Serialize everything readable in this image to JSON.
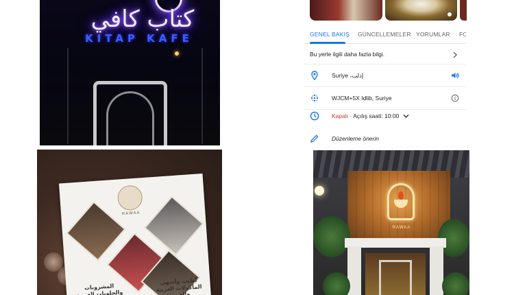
{
  "photos": {
    "sign": {
      "arabic": "كتاب كافي",
      "latin": "KITAP KAFE"
    },
    "menu_card": {
      "brand": "RAWAA",
      "text_left": "المشروبات والحلويات الغربية بمذاق أصيل",
      "text_right": "أطيب وأشهى المأكولات الغربية والعربية"
    },
    "entrance": {
      "logo_text": "RAWAA"
    }
  },
  "tabs": [
    {
      "label": "GENEL BAKIŞ",
      "active": true
    },
    {
      "label": "GÜNCELLEMELER",
      "active": false
    },
    {
      "label": "YORUMLAR",
      "active": false
    },
    {
      "label": "FO",
      "active": false
    }
  ],
  "info": {
    "more_info": "Bu yerle ilgili daha fazla bilgi.",
    "location": "Suriye ،إدلب",
    "plus_code": "WJCM+5X Idlib, Suriye",
    "status_closed": "Kapalı",
    "status_sep": "·",
    "status_hours": "Açılış saati: 10:00",
    "suggest_edit": "Düzenleme önerin"
  },
  "colors": {
    "accent": "#1a73e8",
    "closed": "#d93025",
    "text": "#202124",
    "muted": "#5f6368"
  },
  "icons": {
    "location": "location-pin-icon",
    "plus_code": "plus-code-icon",
    "hours": "clock-icon",
    "edit": "pencil-icon"
  }
}
